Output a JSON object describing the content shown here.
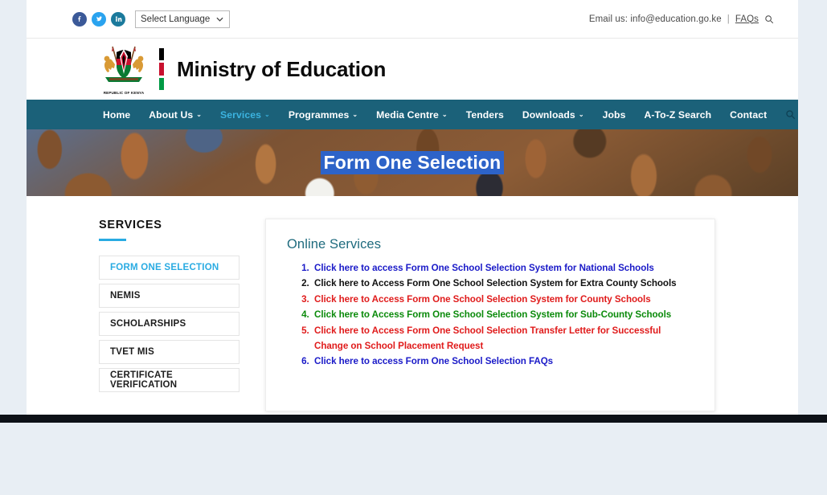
{
  "topbar": {
    "social": [
      {
        "name": "facebook",
        "label": "f"
      },
      {
        "name": "twitter",
        "label": "t"
      },
      {
        "name": "linkedin",
        "label": "in"
      }
    ],
    "language_selected": "Select Language",
    "email_label": "Email us: info@education.go.ke",
    "separator": "|",
    "faqs_label": "FAQs",
    "search_icon": "search-icon"
  },
  "brand": {
    "coat_caption": "REPUBLIC OF KENYA",
    "title": "Ministry of Education"
  },
  "nav": {
    "items": [
      {
        "label": "Home",
        "caret": "",
        "active": false
      },
      {
        "label": "About Us",
        "caret": "⌄",
        "active": false
      },
      {
        "label": "Services",
        "caret": "⌄",
        "active": true
      },
      {
        "label": "Programmes",
        "caret": "⌄",
        "active": false
      },
      {
        "label": "Media Centre",
        "caret": "⌄",
        "active": false
      },
      {
        "label": "Tenders",
        "caret": "",
        "active": false
      },
      {
        "label": "Downloads",
        "caret": "⌄",
        "active": false
      },
      {
        "label": "Jobs",
        "caret": "",
        "active": false
      },
      {
        "label": "A-To-Z Search",
        "caret": "",
        "active": false
      },
      {
        "label": "Contact",
        "caret": "",
        "active": false
      }
    ],
    "search_icon": "search-icon"
  },
  "hero": {
    "title": "Form One Selection"
  },
  "sidebar": {
    "heading": "SERVICES",
    "items": [
      {
        "label": "FORM ONE SELECTION",
        "active": true
      },
      {
        "label": "NEMIS",
        "active": false
      },
      {
        "label": "SCHOLARSHIPS",
        "active": false
      },
      {
        "label": "TVET MIS",
        "active": false
      },
      {
        "label": "CERTIFICATE VERIFICATION",
        "active": false
      }
    ]
  },
  "panel": {
    "title": "Online Services",
    "items": [
      {
        "text": "Click here to access Form One School Selection System for National Schools",
        "color": "#1a1ac8"
      },
      {
        "text": "Click here to Access Form One School Selection System for Extra County Schools",
        "color": "#111111"
      },
      {
        "text": "Click here to Access Form One School Selection System for County Schools",
        "color": "#e01b1b"
      },
      {
        "text": "Click here to Access Form One School Selection System for Sub-County Schools",
        "color": "#0a8a0a"
      },
      {
        "text": "Click here to Access Form One School Selection Transfer Letter for Successful Change on School Placement Request",
        "color": "#e01b1b"
      },
      {
        "text": "Click here to access Form One School Selection FAQs",
        "color": "#1a1ac8"
      }
    ]
  },
  "colors": {
    "navbar": "#1b6179",
    "accent_blue": "#29abe2",
    "panel_title": "#1f6b7e",
    "hero_highlight": "#2d63c8",
    "page_margin": "#e8eef4"
  }
}
